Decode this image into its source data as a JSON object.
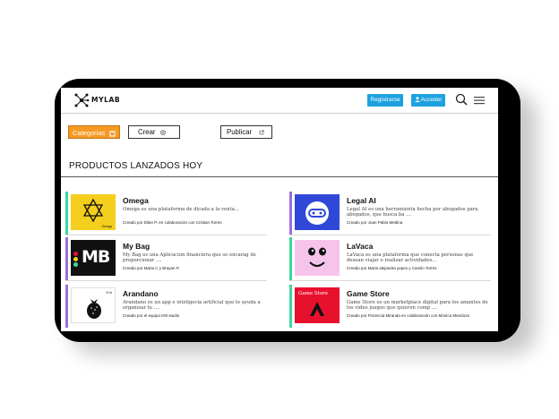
{
  "header": {
    "brand": "MYLAB",
    "register_label": "Registrarse",
    "login_label": "Acceder"
  },
  "filters": {
    "categories_label": "Categorias",
    "create_label": "Crear",
    "publish_label": "Publicar"
  },
  "section_title": "PRODUCTOS LANZADOS HOY",
  "products": [
    {
      "name": "Omega",
      "description": "Omega es una plataforma de dicada a la venta...",
      "credit": "Creado por Dilan P. en colaboración con Cristian Torres",
      "thumb_text": "Omega",
      "accent": "#3ed6a0",
      "thumb_bg": "#f4cf1e"
    },
    {
      "name": "My Bag",
      "description": "My Bag es una Aplicacion financiera que se encarag de proporcionar ....",
      "credit": "Creado por Maria C y Brayan P.",
      "thumb_text": "MB",
      "accent": "#9b6fd6",
      "thumb_bg": "#111111"
    },
    {
      "name": "Arandano",
      "description": "Arandano es un app e inteligecia artificial que te ayuda a organizar tu ....",
      "credit": "Creado por el equipo KM studio",
      "thumb_text": "5 hr",
      "accent": "#9b6fd6",
      "thumb_bg": "#ffffff"
    },
    {
      "name": "Legal AI",
      "description": "Legal AI es una herramienta hecha por abogados para abogados, que busca ba ....",
      "credit": "Creado por Juan Pablo Medina",
      "accent": "#9b6fd6",
      "thumb_bg": "#2f48d8"
    },
    {
      "name": "LaVaca",
      "description": "LaVaca es una plataforma que conecta personas que desean viajar o realizar actividades...",
      "credit": "Creado por Maria alejandra yepes y Camilo Torres",
      "accent": "#3ed6a0",
      "thumb_bg": "#f6c4ea"
    },
    {
      "name": "Game Store",
      "description": "Game Store es un marketplace digital para los amantes de los video juegos que quieren comp ....",
      "credit": "Creado por Florencia Miranda en colaboración con Mónica Mendoza",
      "thumb_text": "Game Store",
      "accent": "#3ed6a0",
      "thumb_bg": "#e8112d"
    }
  ]
}
